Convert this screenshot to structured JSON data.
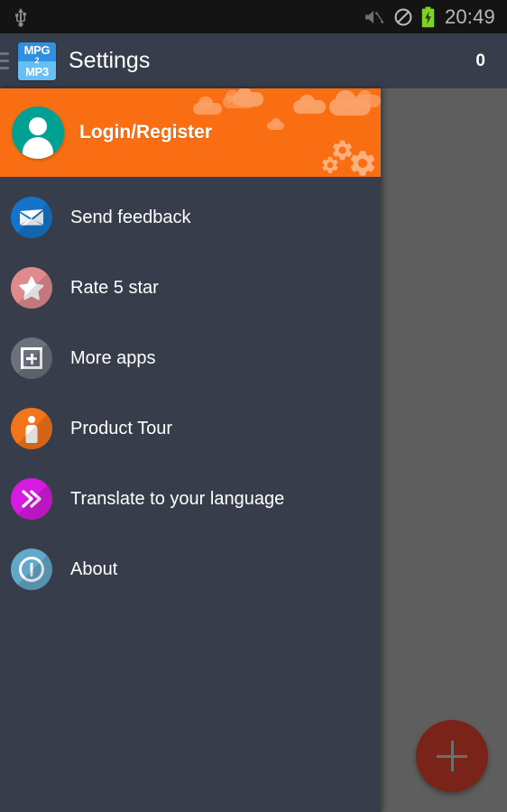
{
  "status_bar": {
    "usb_icon": "usb-icon",
    "mute_icon": "volume-muted-icon",
    "dnd_icon": "do-not-disturb-icon",
    "battery_icon": "battery-charging-icon",
    "time": "20:49",
    "background_color": "#141414",
    "text_color": "#b9b9b9"
  },
  "action_bar": {
    "menu_icon": "hamburger-menu-icon",
    "app_icon": {
      "name": "mpg2mp3-app-icon",
      "line1": "MPG",
      "line2": "2",
      "line3": "MP3"
    },
    "title": "Settings",
    "counter": "0",
    "background_color": "#373d4a"
  },
  "drawer": {
    "background_color": "#373d4a",
    "header": {
      "background_color": "#f96e12",
      "avatar_icon": "user-avatar-icon",
      "avatar_color": "#00a093",
      "label": "Login/Register",
      "decor_cloud_color": "#fba269",
      "decor_gear_color": "#fcb07c"
    },
    "items": [
      {
        "label": "Send feedback",
        "icon": "envelope-icon",
        "color": "#1574c9"
      },
      {
        "label": "Rate 5 star",
        "icon": "star-icon",
        "color": "#e08a8d"
      },
      {
        "label": "More apps",
        "icon": "add-box-icon",
        "color": "#6b717d"
      },
      {
        "label": "Product Tour",
        "icon": "person-icon",
        "color": "#f4741a"
      },
      {
        "label": "Translate to your language",
        "icon": "double-chevron-right-icon",
        "color": "#d61ae0"
      },
      {
        "label": "About",
        "icon": "info-exclamation-icon",
        "color": "#62a8c9"
      }
    ]
  },
  "content": {
    "scrim_color": "#5e5e5e",
    "fab": {
      "name": "add-fab",
      "icon": "plus-icon",
      "color": "#7a2318"
    }
  }
}
